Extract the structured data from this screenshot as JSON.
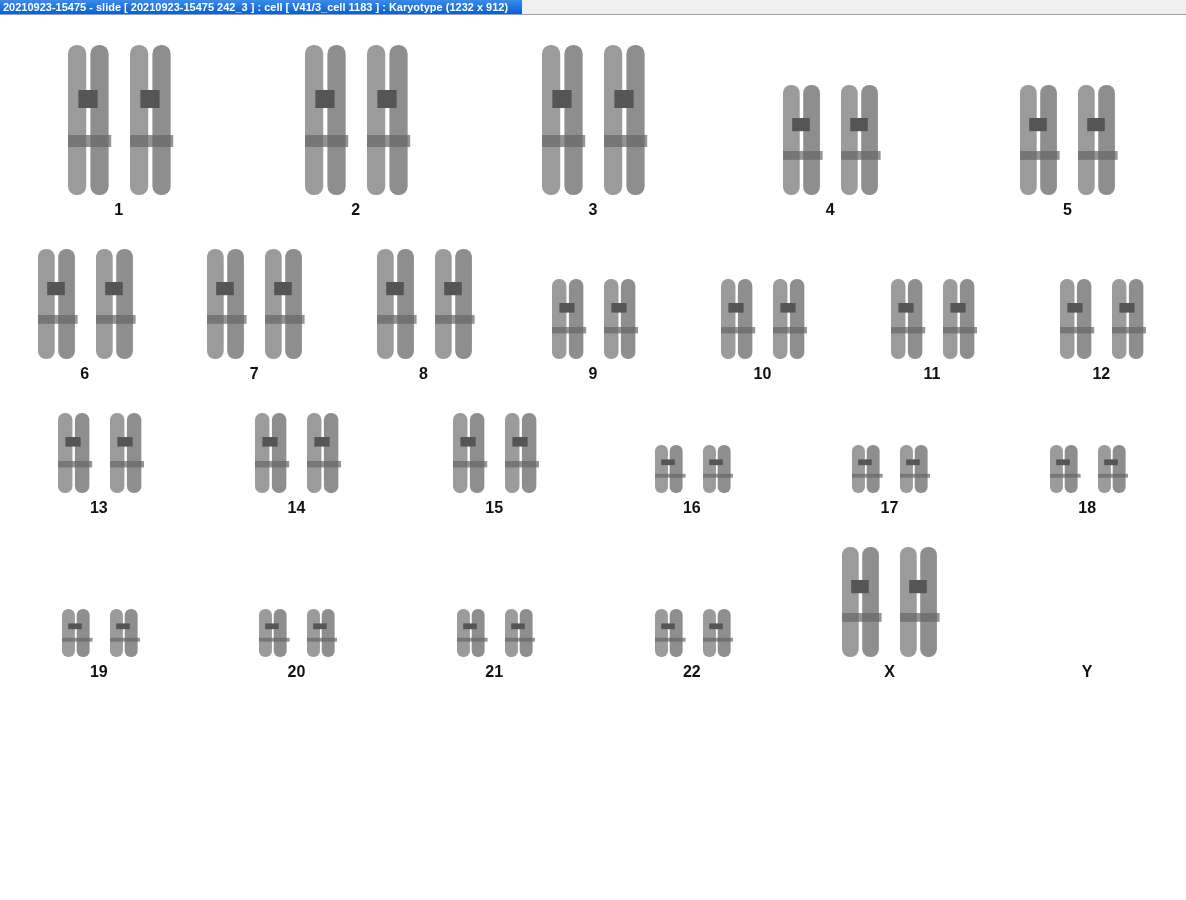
{
  "window": {
    "title": "20210923-15475 - slide [ 20210923-15475 242_3 ] : cell [ V41/3_cell 1183 ] : Karyotype  (1232 x 912)"
  },
  "karyotype": {
    "rows": [
      {
        "items": [
          {
            "label": "1",
            "kind": "large"
          },
          {
            "label": "2",
            "kind": "large"
          },
          {
            "label": "3",
            "kind": "large"
          },
          {
            "label": "4",
            "kind": "medium"
          },
          {
            "label": "5",
            "kind": "medium"
          }
        ]
      },
      {
        "items": [
          {
            "label": "6",
            "kind": "medium"
          },
          {
            "label": "7",
            "kind": "medium"
          },
          {
            "label": "8",
            "kind": "medium"
          },
          {
            "label": "9",
            "kind": "small"
          },
          {
            "label": "10",
            "kind": "small"
          },
          {
            "label": "11",
            "kind": "small"
          },
          {
            "label": "12",
            "kind": "small"
          }
        ]
      },
      {
        "items": [
          {
            "label": "13",
            "kind": "small"
          },
          {
            "label": "14",
            "kind": "small"
          },
          {
            "label": "15",
            "kind": "small"
          },
          {
            "label": "16",
            "kind": "tiny"
          },
          {
            "label": "17",
            "kind": "tiny"
          },
          {
            "label": "18",
            "kind": "tiny"
          }
        ]
      },
      {
        "items": [
          {
            "label": "19",
            "kind": "tiny"
          },
          {
            "label": "20",
            "kind": "tiny"
          },
          {
            "label": "21",
            "kind": "tiny"
          },
          {
            "label": "22",
            "kind": "tiny"
          },
          {
            "label": "X",
            "kind": "medium"
          },
          {
            "label": "Y",
            "kind": "none"
          }
        ]
      }
    ]
  }
}
